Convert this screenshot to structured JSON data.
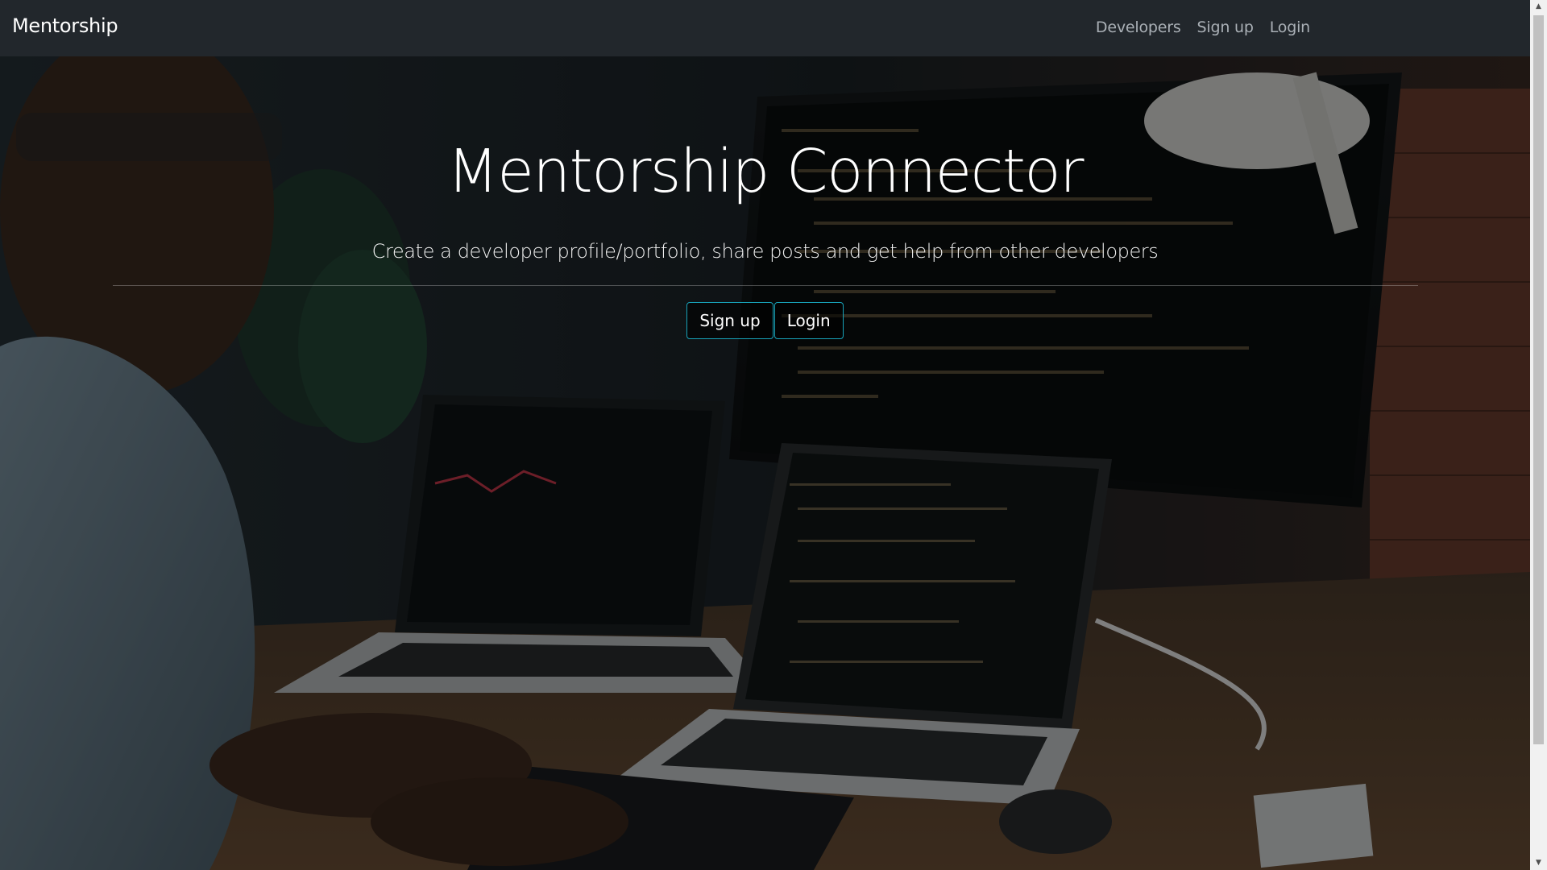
{
  "navbar": {
    "brand": "Mentorship",
    "links": [
      "Developers",
      "Sign up",
      "Login"
    ]
  },
  "hero": {
    "title": "Mentorship Connector",
    "lead": "Create a developer profile/portfolio, share posts and get help from other developers",
    "buttons": {
      "signup": "Sign up",
      "login": "Login"
    }
  },
  "colors": {
    "navbar_bg": "#22272c",
    "button_border": "#17a2b8",
    "overlay": "rgba(0,0,0,0.45)"
  },
  "icons": {
    "scroll_up": "triangle-up-icon",
    "scroll_down": "triangle-down-icon"
  }
}
